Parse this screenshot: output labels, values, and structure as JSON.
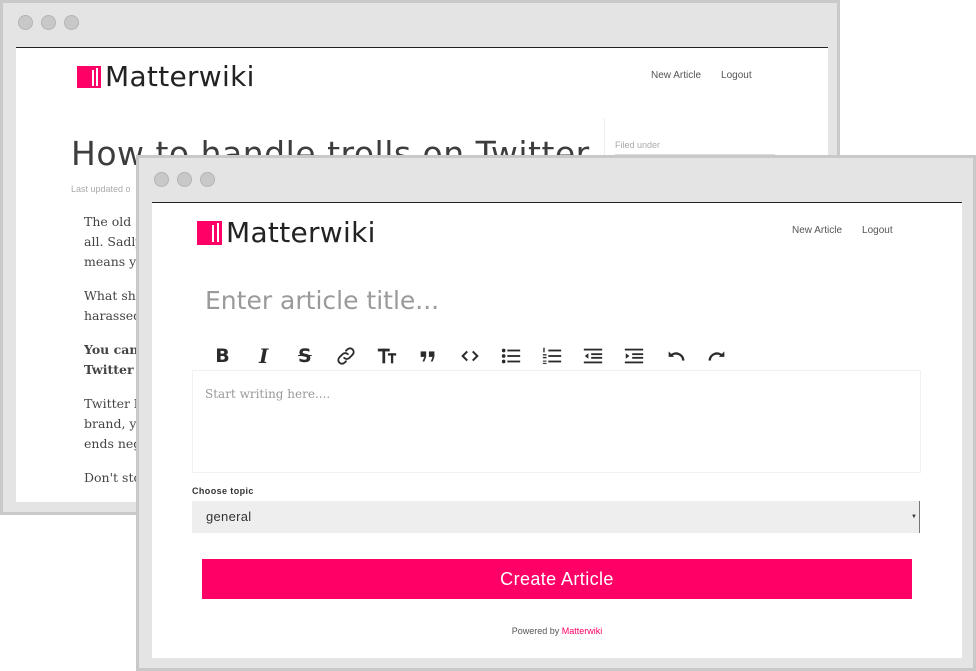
{
  "colors": {
    "accent": "#ff0066",
    "frame": "#e4e4e4",
    "text": "#3d3d3d",
    "muted": "#999999"
  },
  "back_window": {
    "brand": "Matterwiki",
    "nav": [
      "New Article",
      "Logout"
    ],
    "article_title": "How to handle trolls on Twitter",
    "last_updated": "Last updated o",
    "paragraphs": [
      {
        "lines": [
          "The old s",
          "all. Sadly",
          "means yo"
        ]
      },
      {
        "lines": [
          "What sho",
          "harassed"
        ]
      },
      {
        "lines": [
          "You can'",
          "Twitter f"
        ],
        "bold": true
      },
      {
        "lines": [
          "Twitter b",
          "brand, yo",
          "ends neg"
        ]
      },
      {
        "lines": [
          "Don't sto"
        ]
      }
    ],
    "sidebar_label": "Filed under"
  },
  "front_window": {
    "brand": "Matterwiki",
    "nav": [
      "New Article",
      "Logout"
    ],
    "title_placeholder": "Enter article title...",
    "toolbar": [
      {
        "name": "bold",
        "icon": "bold-icon"
      },
      {
        "name": "italic",
        "icon": "italic-icon"
      },
      {
        "name": "strikethrough",
        "icon": "strikethrough-icon"
      },
      {
        "name": "link",
        "icon": "link-icon"
      },
      {
        "name": "heading",
        "icon": "heading-icon"
      },
      {
        "name": "quote",
        "icon": "quote-icon"
      },
      {
        "name": "code",
        "icon": "code-icon"
      },
      {
        "name": "bulleted-list",
        "icon": "bulleted-list-icon"
      },
      {
        "name": "numbered-list",
        "icon": "numbered-list-icon"
      },
      {
        "name": "outdent",
        "icon": "outdent-icon"
      },
      {
        "name": "indent",
        "icon": "indent-icon"
      },
      {
        "name": "undo",
        "icon": "undo-icon"
      },
      {
        "name": "redo",
        "icon": "redo-icon"
      }
    ],
    "editor_placeholder": "Start writing here....",
    "topic_label": "Choose topic",
    "topic_value": "general",
    "create_button": "Create Article",
    "footer_prefix": "Powered by ",
    "footer_link": "Matterwiki"
  }
}
